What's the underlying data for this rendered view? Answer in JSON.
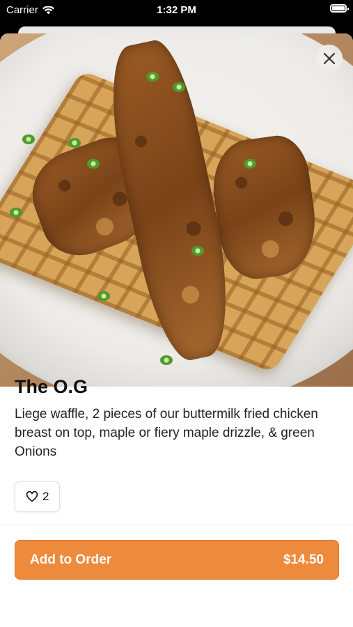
{
  "status_bar": {
    "carrier": "Carrier",
    "time": "1:32 PM",
    "icons": [
      "wifi-icon",
      "battery-icon"
    ]
  },
  "item": {
    "name": "The O.G",
    "description": "Liege waffle, 2 pieces of our buttermilk fried chicken breast on top, maple or fiery maple drizzle, & green Onions",
    "likes": "2",
    "like_icon": "heart-outline-icon"
  },
  "close_icon": "close-icon",
  "order": {
    "label": "Add to Order",
    "price": "$14.50"
  },
  "colors": {
    "accent": "#ee8a3c",
    "accent_border": "#d77326"
  }
}
